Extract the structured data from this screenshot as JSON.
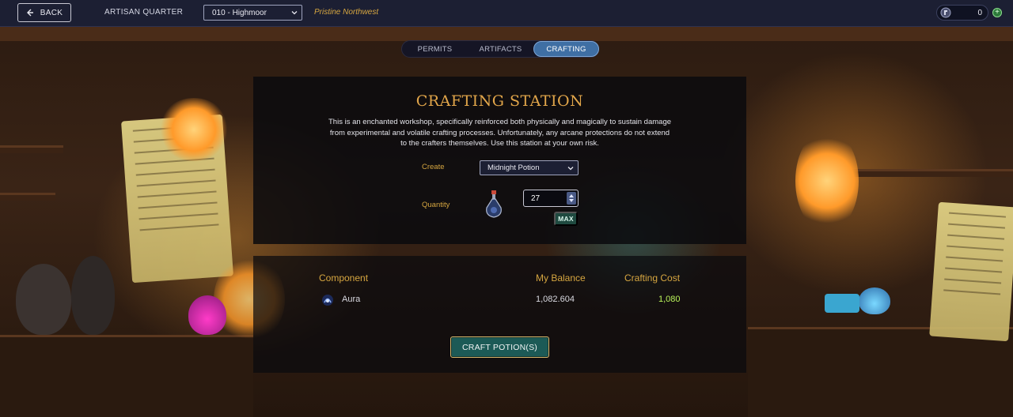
{
  "topbar": {
    "back_label": "BACK",
    "area_title": "ARTISAN QUARTER",
    "land_select_value": "010 - Highmoor",
    "region": "Pristine Northwest",
    "balance_value": "0",
    "coin_icon": "coin-icon",
    "add_icon": "plus-icon"
  },
  "tabs": [
    {
      "label": "PERMITS",
      "active": false
    },
    {
      "label": "ARTIFACTS",
      "active": false
    },
    {
      "label": "CRAFTING",
      "active": true
    }
  ],
  "station": {
    "title": "CRAFTING STATION",
    "description": "This is an enchanted workshop, specifically reinforced both physically and magically to sustain damage from experimental and volatile crafting processes. Unfortunately, any arcane protections do not extend to the crafters themselves. Use this station at your own risk.",
    "create_label": "Create",
    "create_value": "Midnight Potion",
    "quantity_label": "Quantity",
    "quantity_value": "27",
    "max_label": "MAX"
  },
  "components": {
    "headers": {
      "component": "Component",
      "balance": "My Balance",
      "cost": "Crafting Cost"
    },
    "rows": [
      {
        "name": "Aura",
        "balance": "1,082.604",
        "cost": "1,080",
        "icon": "aura-icon"
      }
    ],
    "craft_label": "CRAFT POTION(S)"
  },
  "colors": {
    "accent_gold": "#d6a640",
    "tab_active": "#3f6fa4",
    "cost_green": "#b9f25a",
    "craft_button": "#1c5a56"
  }
}
